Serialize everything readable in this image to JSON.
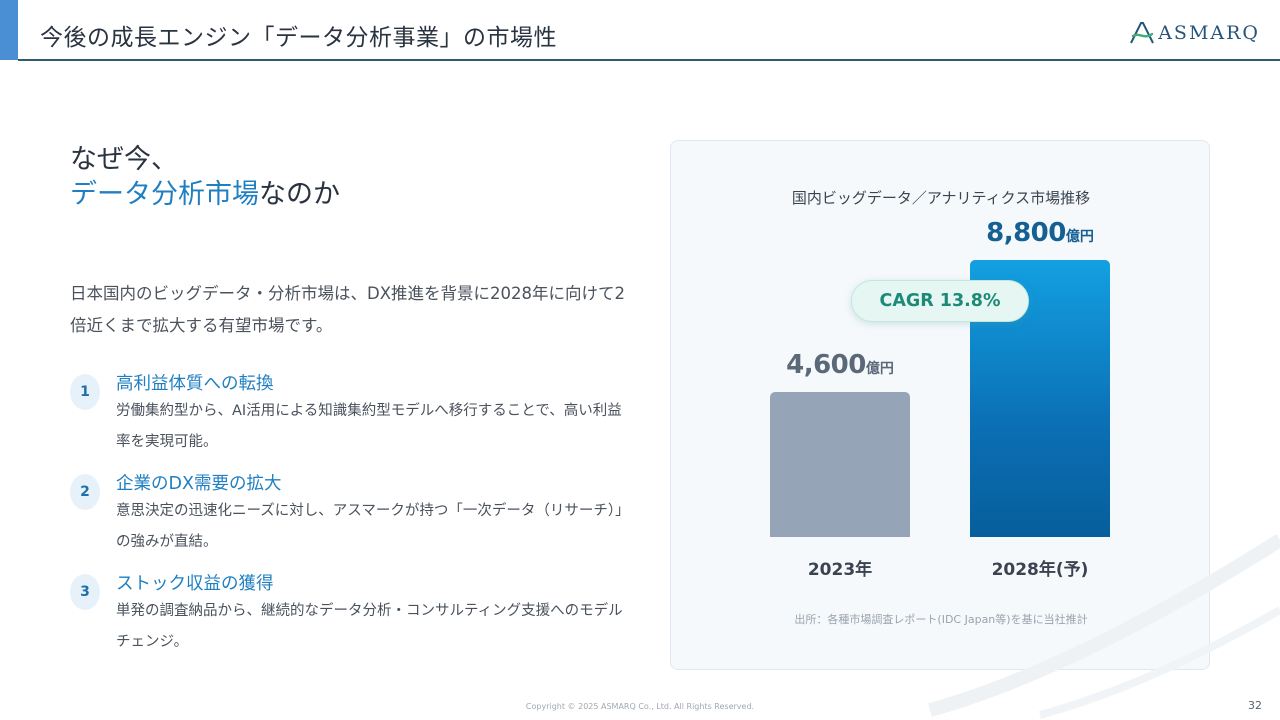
{
  "header": {
    "title": "今後の成長エンジン「データ分析事業」の市場性",
    "logo_text": "ASMARQ"
  },
  "heading": {
    "line1": "なぜ今、",
    "highlight": "データ分析市場",
    "rest": "なのか"
  },
  "intro": "日本国内のビッグデータ・分析市場は、DX推進を背景に2028年に向けて2倍近くまで拡大する有望市場です。",
  "points": [
    {
      "num": "1",
      "title": "高利益体質への転換",
      "desc": "労働集約型から、AI活用による知識集約型モデルへ移行することで、高い利益率を実現可能。"
    },
    {
      "num": "2",
      "title": "企業のDX需要の拡大",
      "desc": "意思決定の迅速化ニーズに対し、アスマークが持つ「一次データ（リサーチ）」の強みが直結。"
    },
    {
      "num": "3",
      "title": "ストック収益の獲得",
      "desc": "単発の調査納品から、継続的なデータ分析・コンサルティング支援へのモデルチェンジ。"
    }
  ],
  "chart_data": {
    "type": "bar",
    "title": "国内ビッグデータ／アナリティクス市場推移",
    "categories": [
      "2023年",
      "2028年(予)"
    ],
    "values": [
      4600,
      8800
    ],
    "value_labels": [
      "4,600",
      "8,800"
    ],
    "unit": "億円",
    "ylim": [
      0,
      9200
    ],
    "annotation": "CAGR 13.8%",
    "source": "出所：各種市場調査レポート(IDC Japan等)を基に当社推計",
    "colors": [
      "#95a4b7",
      "#0b7cc4"
    ],
    "grid": false
  },
  "footer": {
    "copyright": "Copyright © 2025 ASMARQ Co., Ltd. All Rights Reserved.",
    "page": "32"
  }
}
